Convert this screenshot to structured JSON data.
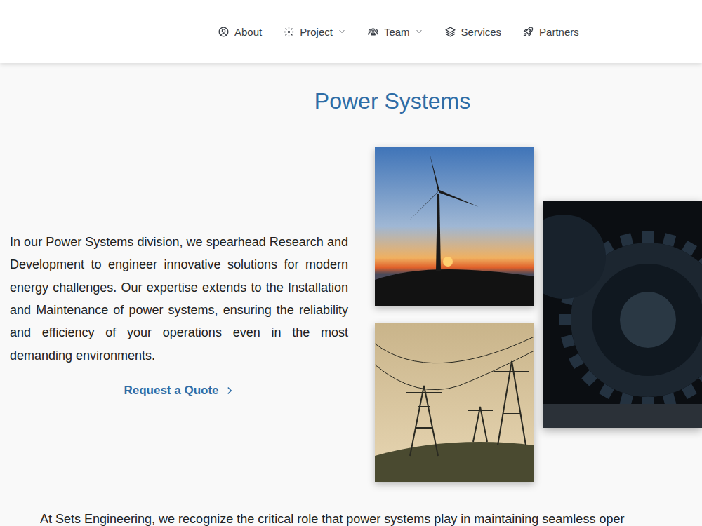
{
  "nav": {
    "items": [
      {
        "label": "About",
        "dropdown": false,
        "icon": "user"
      },
      {
        "label": "Project",
        "dropdown": true,
        "icon": "project"
      },
      {
        "label": "Team",
        "dropdown": true,
        "icon": "team"
      },
      {
        "label": "Services",
        "dropdown": false,
        "icon": "layers"
      },
      {
        "label": "Partners",
        "dropdown": false,
        "icon": "rocket"
      }
    ]
  },
  "title": "Power Systems",
  "intro": "In our Power Systems division, we spearhead Research and Development to engineer innovative solutions for modern energy challenges. Our expertise extends to the Installation and Maintenance of power systems, ensuring the reliability and efficiency of your operations even in the most demanding environments.",
  "cta": "Request a Quote",
  "bottom_text": "At Sets Engineering, we recognize the critical role that power systems play in maintaining seamless oper"
}
